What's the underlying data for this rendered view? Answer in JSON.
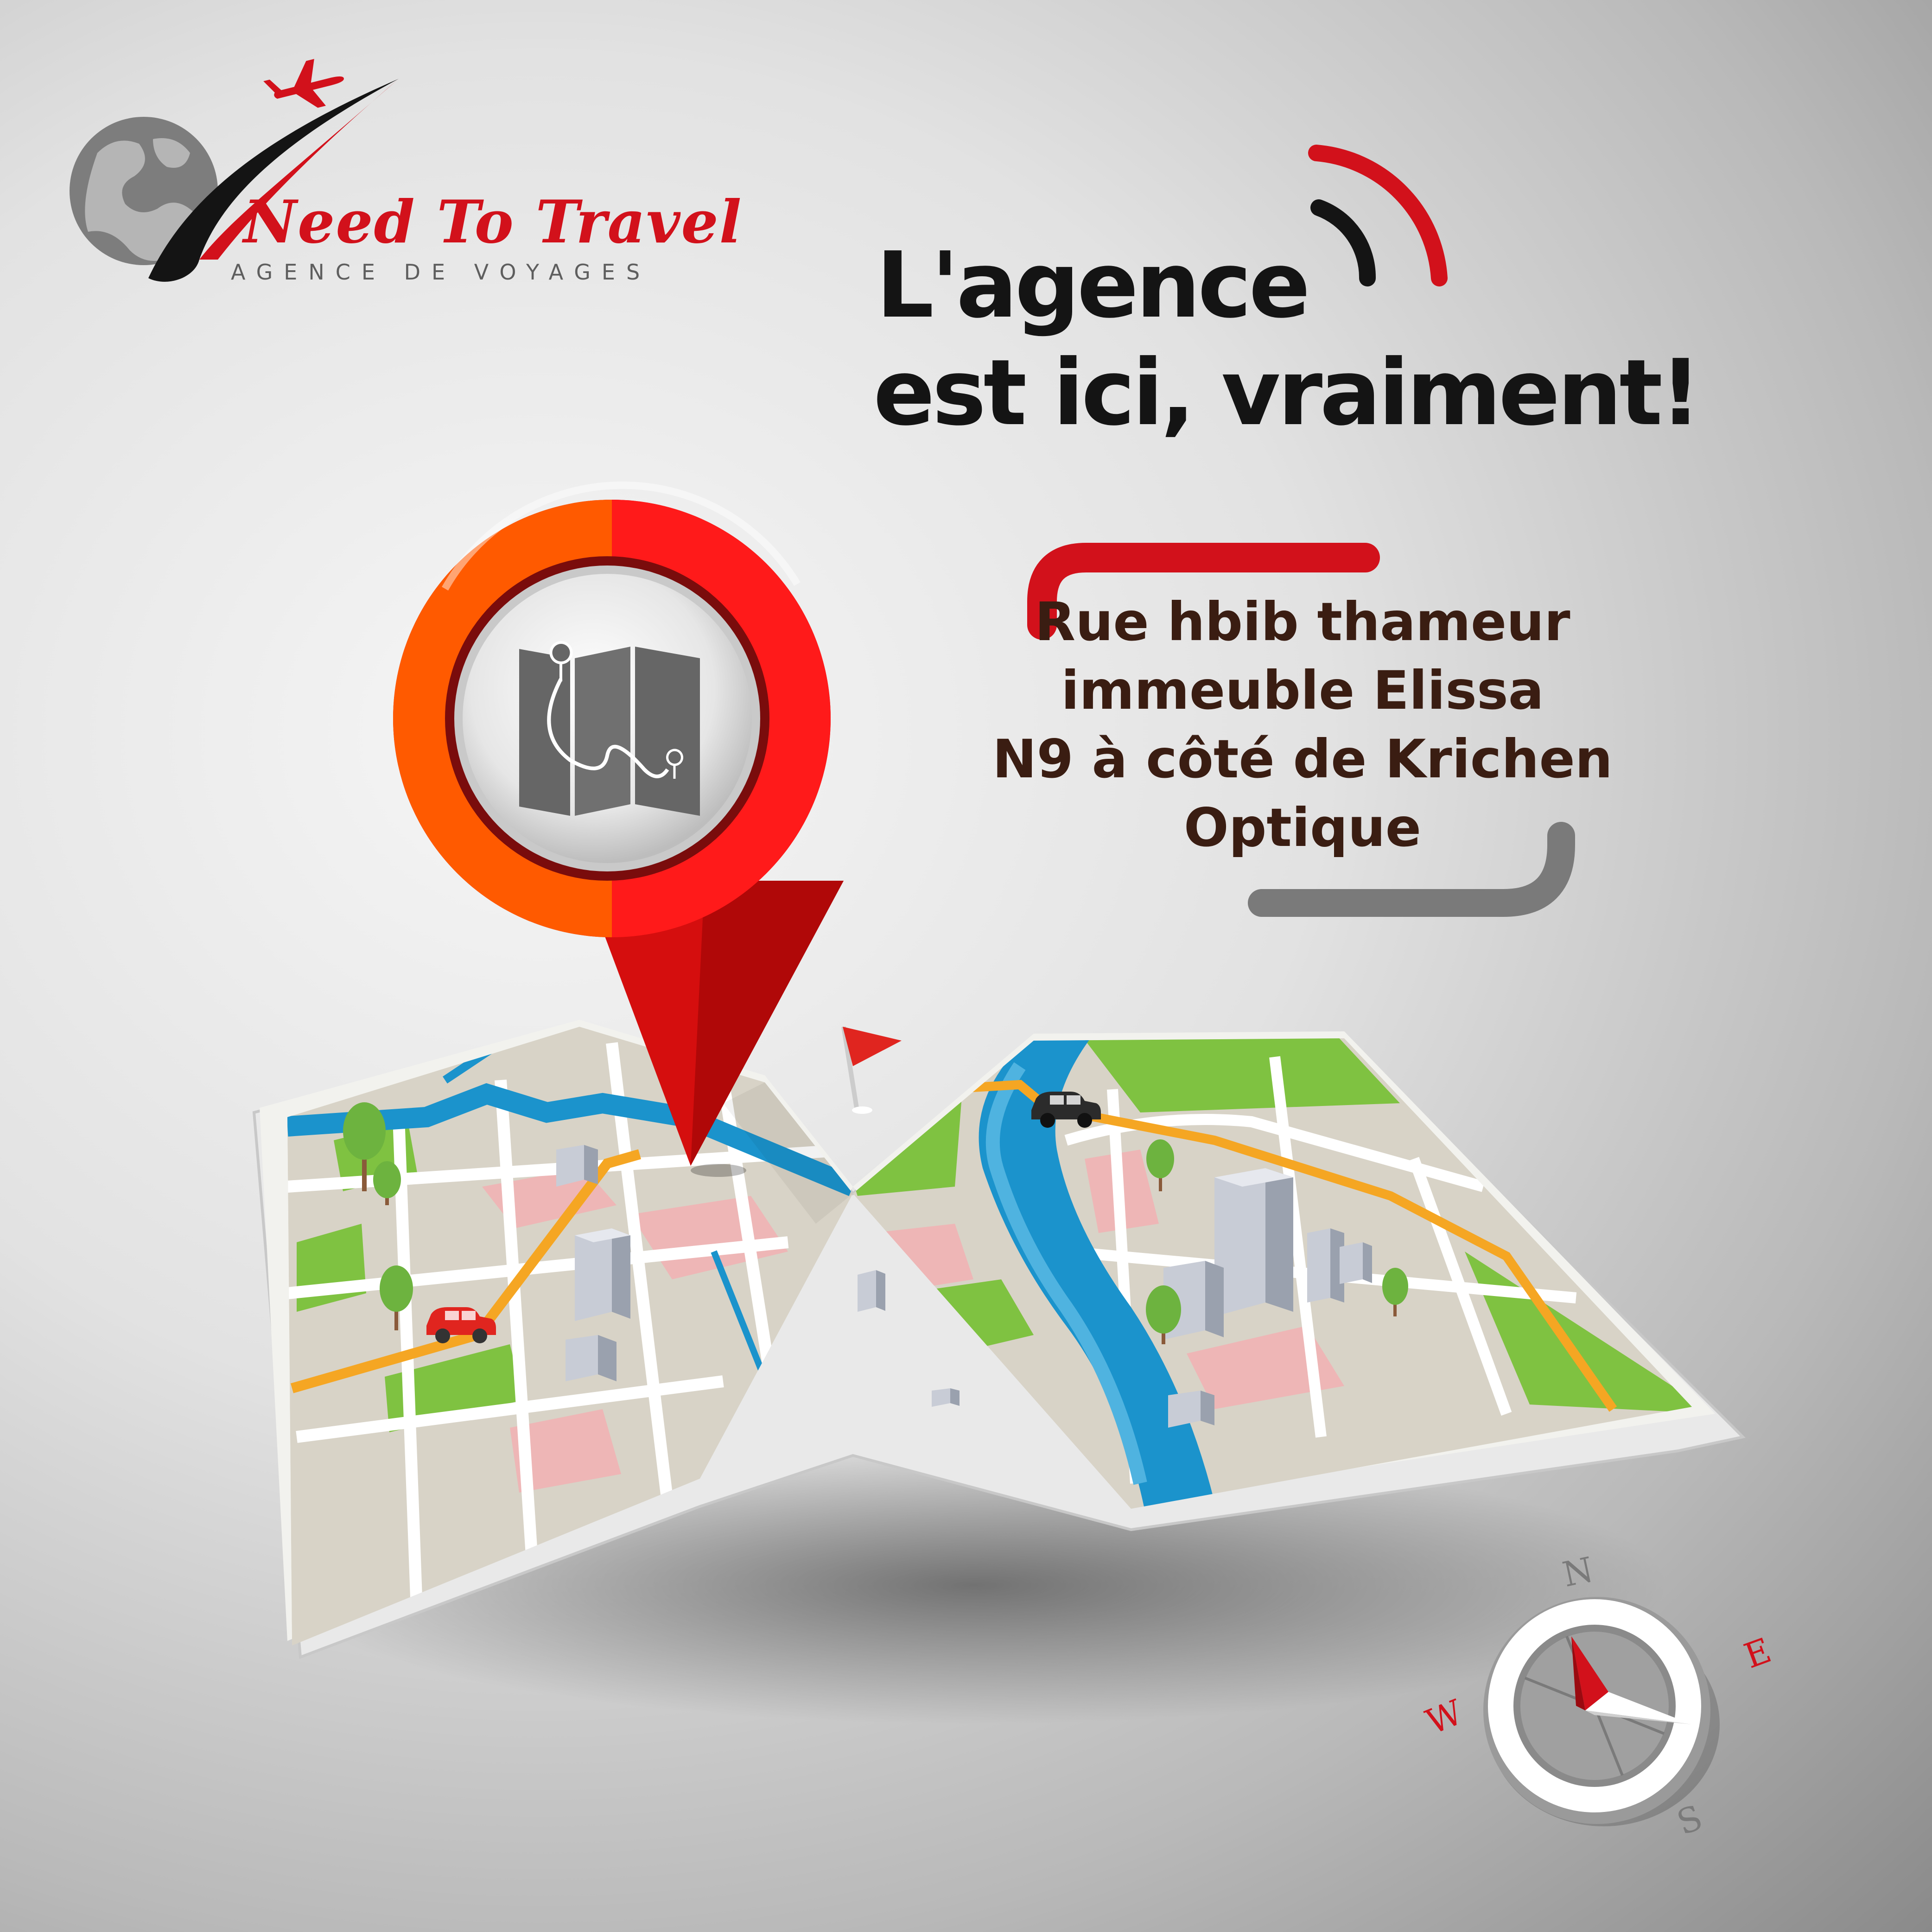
{
  "brand": {
    "name": "Need To Travel",
    "tagline": "AGENCE DE VOYAGES",
    "icons": [
      "globe-icon",
      "airplane-icon",
      "swoosh-icon"
    ]
  },
  "headline": {
    "line1": "L'agence",
    "line2": "est ici, vraiment!"
  },
  "address": {
    "lines": [
      "Rue hbib thameur",
      "immeuble Elissa",
      "N9 à côté de Krichen",
      "Optique"
    ]
  },
  "compass": {
    "north": "N",
    "east": "E",
    "south": "S",
    "west": "W"
  },
  "colors": {
    "brand_red": "#d2111b",
    "headline_black": "#141414",
    "address_brown": "#3a1d12",
    "accent_gray": "#7a7a7a",
    "river_blue": "#1b93cc",
    "park_green": "#7fc241",
    "road_orange": "#f5a623"
  }
}
